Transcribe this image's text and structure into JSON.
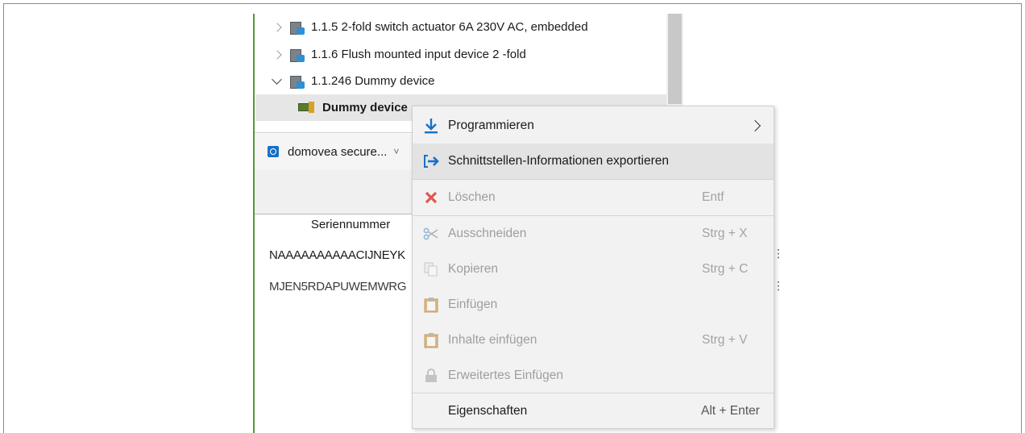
{
  "tree": {
    "items": [
      {
        "label": "1.1.5 2-fold switch actuator 6A 230V AC, embedded"
      },
      {
        "label": "1.1.6 Flush mounted input device 2 -fold"
      },
      {
        "label": "1.1.246 Dummy device"
      }
    ],
    "selected_child": "Dummy device"
  },
  "interface": {
    "secure_label": "domovea secure...",
    "dropdown_icon": "chevron-down-icon"
  },
  "table": {
    "column_header": "Seriennummer",
    "rows": [
      "NAAAAAAAAAACIJNEYK",
      "MJEN5RDAPUWEMWRG"
    ]
  },
  "menu": {
    "items": [
      {
        "label": "Programmieren",
        "shortcut": "",
        "icon": "download-arrow-icon",
        "enabled": true
      },
      {
        "label": "Schnittstellen-Informationen exportieren",
        "shortcut": "",
        "icon": "export-arrow-icon",
        "enabled": true
      },
      {
        "label": "Löschen",
        "shortcut": "Entf",
        "icon": "delete-x-icon",
        "enabled": false
      },
      {
        "label": "Ausschneiden",
        "shortcut": "Strg + X",
        "icon": "scissors-icon",
        "enabled": false
      },
      {
        "label": "Kopieren",
        "shortcut": "Strg + C",
        "icon": "copy-icon",
        "enabled": false
      },
      {
        "label": "Einfügen",
        "shortcut": "",
        "icon": "paste-clipboard-icon",
        "enabled": false
      },
      {
        "label": "Inhalte einfügen",
        "shortcut": "Strg + V",
        "icon": "paste-contents-icon",
        "enabled": false
      },
      {
        "label": "Erweitertes Einfügen",
        "shortcut": "",
        "icon": "lock-paste-icon",
        "enabled": false
      },
      {
        "label": "Eigenschaften",
        "shortcut": "Alt + Enter",
        "icon": "",
        "enabled": true
      }
    ]
  },
  "colors": {
    "accent_blue": "#1770c8",
    "delete_red": "#e2574c",
    "tree_green": "#4f9a3c"
  }
}
